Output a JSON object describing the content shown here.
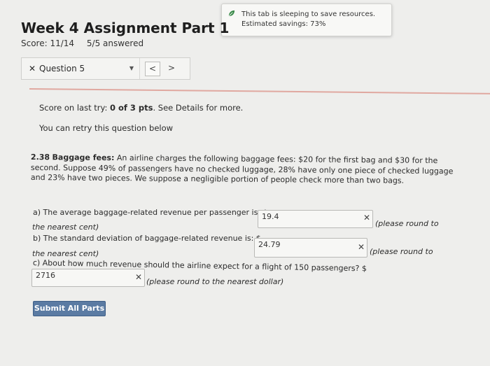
{
  "notification": {
    "line1": "This tab is sleeping to save resources.",
    "line2": "Estimated savings: 73%"
  },
  "header": {
    "title": "Week 4 Assignment Part 1",
    "score": "Score: 11/14",
    "answered": "5/5 answered"
  },
  "question_nav": {
    "label": "Question 5",
    "prev": "<",
    "next": ">"
  },
  "feedback": {
    "score_prefix": "Score on last try: ",
    "score_value": "0 of 3 pts",
    "score_suffix": ". See Details for more.",
    "retry": "You can retry this question below"
  },
  "problem": {
    "number": "2.38",
    "heading": "Baggage fees:",
    "line1": "An airline charges the following baggage fees: $20 for the first bag and $30 for the",
    "line2": "second. Suppose 49% of passengers have no checked luggage, 28% have only one piece of checked luggage",
    "line3": "and 23% have two pieces. We suppose a negligible portion of people check more than two bags."
  },
  "parts": {
    "a_label": "a) The average baggage-related revenue per passenger is: $",
    "a_value": "19.4",
    "a_round_1": "(please round to",
    "a_round_2": "the nearest cent)",
    "b_label": "b) The standard deviation of baggage-related revenue is: $",
    "b_value": "24.79",
    "b_round_1": "(please round to",
    "b_round_2": "the nearest cent)",
    "c_label": "c) About how much revenue should the airline expect for a flight of 150 passengers? $",
    "c_value": "2716",
    "c_round": "(please round to the nearest dollar)",
    "wrong_mark": "✕"
  },
  "actions": {
    "submit": "Submit All Parts"
  },
  "colors": {
    "submit_bg": "#5b7ba3",
    "divider": "#e0a8a0",
    "leaf_icon": "#3a8a4a"
  },
  "icons": {
    "notification": "leaf-icon",
    "wrong": "x-icon",
    "dropdown": "caret-down-icon"
  }
}
